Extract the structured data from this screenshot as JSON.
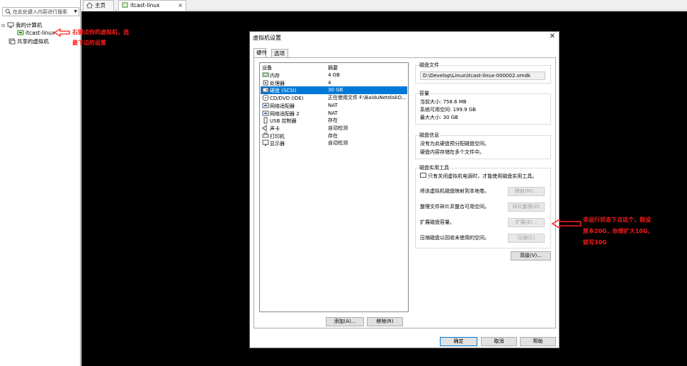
{
  "library": {
    "search_placeholder": "在此处键入内容进行搜索",
    "tree": {
      "my_computer": "我的计算机",
      "vm_item": "itcast-linux",
      "shared_vms": "共享的虚拟机"
    }
  },
  "tabs": [
    {
      "label": "主页"
    },
    {
      "label": "itcast-linux"
    }
  ],
  "annotations": {
    "note1_line1": "右键点你的虚拟机，选",
    "note1_line2": "最下边的设置",
    "note2_line1": "非运行状态下点这个，假设",
    "note2_line2": "原本20G，你想扩大10G，",
    "note2_line3": "就写30G",
    "color": "#ff1a1a"
  },
  "dialog": {
    "title": "虚拟机设置",
    "tabs": [
      "硬件",
      "选项"
    ],
    "device_header": "设备",
    "summary_header": "摘要",
    "devices": [
      {
        "name": "内存",
        "summary": "4 GB",
        "icon": "memory-icon"
      },
      {
        "name": "处理器",
        "summary": "4",
        "icon": "cpu-icon"
      },
      {
        "name": "硬盘 (SCSI)",
        "summary": "30 GB",
        "icon": "harddisk-icon"
      },
      {
        "name": "CD/DVD (IDE)",
        "summary": "正在使用文件 F:\\BaiduNetdiskD...",
        "icon": "cd-dvd-icon"
      },
      {
        "name": "网络适配器",
        "summary": "NAT",
        "icon": "network-adapter-icon"
      },
      {
        "name": "网络适配器 2",
        "summary": "NAT",
        "icon": "network-adapter-icon"
      },
      {
        "name": "USB 控制器",
        "summary": "存在",
        "icon": "usb-icon"
      },
      {
        "name": "声卡",
        "summary": "自动检测",
        "icon": "sound-card-icon"
      },
      {
        "name": "打印机",
        "summary": "存在",
        "icon": "printer-icon"
      },
      {
        "name": "显示器",
        "summary": "自动检测",
        "icon": "display-icon"
      }
    ],
    "selected_device_index": 2,
    "add_button": "添加(A)...",
    "remove_button": "移除(R)",
    "disk_file": {
      "title": "磁盘文件",
      "value": "D:\\Develop\\Linux\\itcast-linux-000002.vmdk"
    },
    "capacity": {
      "title": "容量",
      "current": "当前大小: 758.6 MB",
      "free": "系统可用空间: 199.9 GB",
      "max": "最大大小: 30 GB"
    },
    "disk_info": {
      "title": "磁盘信息",
      "line1": "没有为此硬盘预分配磁盘空间。",
      "line2": "硬盘内容存储在多个文件中。"
    },
    "utilities": {
      "title": "磁盘实用工具",
      "info": "只有关闭虚拟机电源时，才能使用磁盘实用工具。",
      "map_label": "将该虚拟机磁盘映射到本地卷。",
      "map_button": "映射(M)...",
      "defrag_label": "整理文件碎片并整合可用空间。",
      "defrag_button": "碎片整理(D)",
      "expand_label": "扩展磁盘容量。",
      "expand_button": "扩展(E)...",
      "compact_label": "压缩磁盘以回收未使用的空间。",
      "compact_button": "压缩(C)"
    },
    "advanced_button": "高级(V)...",
    "ok_button": "确定",
    "cancel_button": "取消",
    "help_button": "帮助"
  }
}
